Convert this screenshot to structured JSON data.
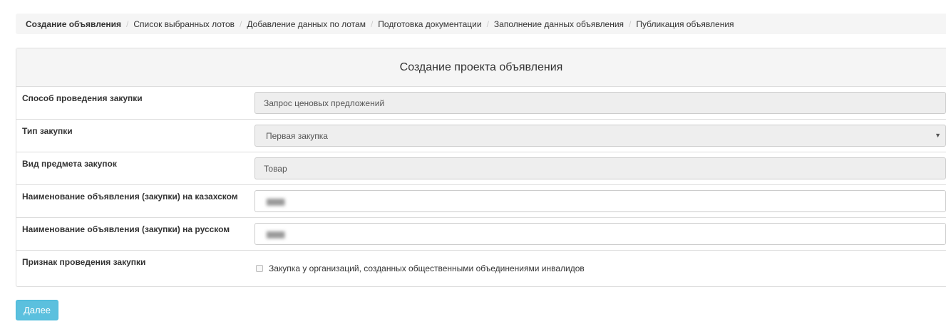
{
  "breadcrumb": {
    "items": [
      "Создание объявления",
      "Список выбранных лотов",
      "Добавление данных по лотам",
      "Подготовка документации",
      "Заполнение данных объявления",
      "Публикация объявления"
    ],
    "separator": "/",
    "active_index": 0
  },
  "panel": {
    "title": "Создание проекта объявления",
    "rows": [
      {
        "label": "Способ проведения закупки",
        "value": "Запрос ценовых предложений",
        "type": "readonly"
      },
      {
        "label": "Тип закупки",
        "value": "Первая закупка",
        "type": "select"
      },
      {
        "label": "Вид предмета закупок",
        "value": "Товар",
        "type": "readonly"
      },
      {
        "label": "Наименование объявления (закупки) на казахском",
        "value": "",
        "type": "text"
      },
      {
        "label": "Наименование объявления (закупки) на русском",
        "value": "",
        "type": "text"
      },
      {
        "label": "Признак проведения закупки",
        "checkbox_label": "Закупка у организаций, созданных общественными объединениями инвалидов",
        "checked": false,
        "type": "checkbox"
      }
    ]
  },
  "actions": {
    "next_label": "Далее"
  },
  "colors": {
    "accent_button": "#5bc0de",
    "readonly_bg": "#eeeeee",
    "breadcrumb_bg": "#f5f5f5"
  }
}
